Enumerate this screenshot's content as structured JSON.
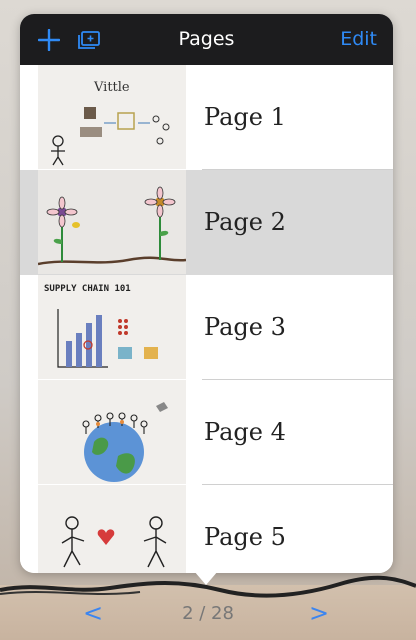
{
  "header": {
    "title": "Pages",
    "edit_label": "Edit",
    "add_icon": "plus-icon",
    "add_page_icon": "add-page-icon"
  },
  "pages": [
    {
      "label": "Page 1",
      "thumb_text": "Vittle",
      "selected": false
    },
    {
      "label": "Page 2",
      "thumb_text": "",
      "selected": true
    },
    {
      "label": "Page 3",
      "thumb_text": "SUPPLY CHAIN 101",
      "selected": false
    },
    {
      "label": "Page 4",
      "thumb_text": "",
      "selected": false
    },
    {
      "label": "Page 5",
      "thumb_text": "",
      "selected": false
    }
  ],
  "nav": {
    "prev": "<",
    "next": ">",
    "indicator": "2 / 28"
  },
  "colors": {
    "accent": "#2f8af5",
    "header_bg": "#1c1c1e",
    "selected_row": "#d9d9d9"
  }
}
